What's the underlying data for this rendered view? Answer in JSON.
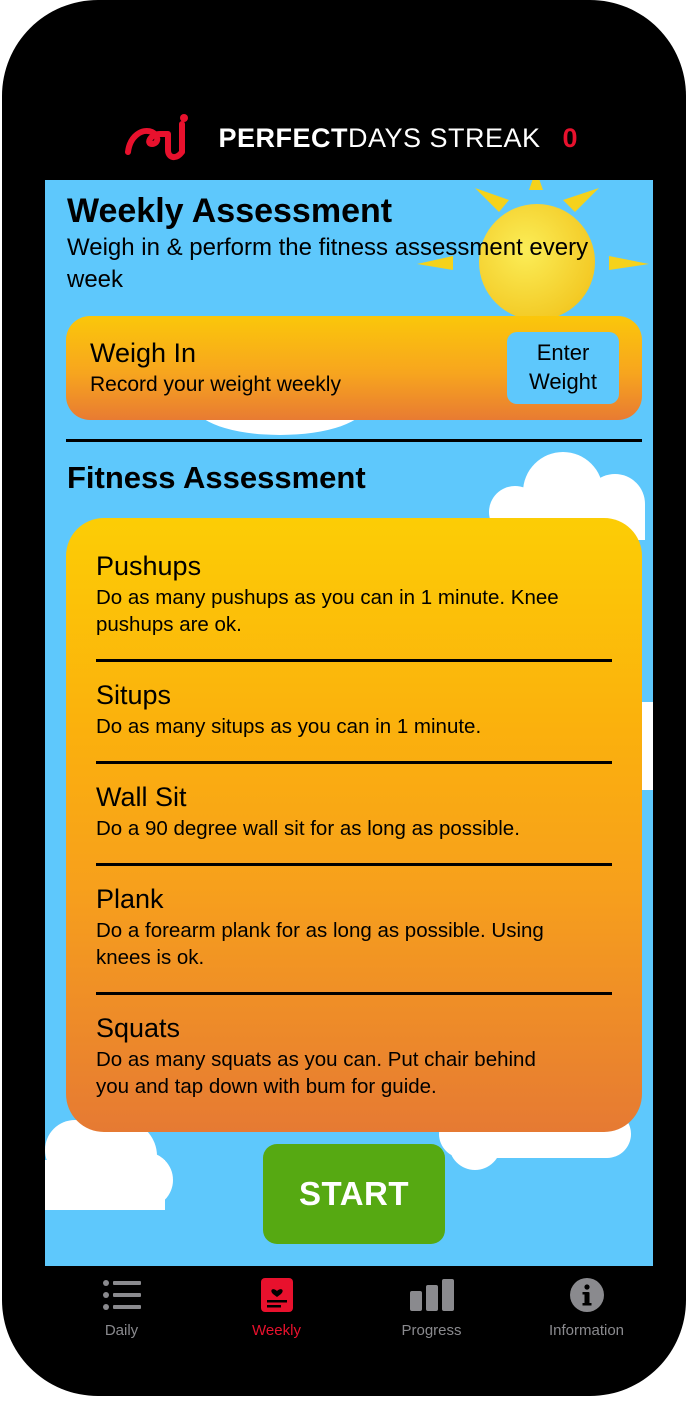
{
  "colors": {
    "brand_red": "#e8112d",
    "sky_blue": "#5ec8fc",
    "card_orange_top": "#fbc70a",
    "card_orange_bottom": "#e87b32",
    "start_green": "#56a912",
    "tab_inactive": "#8a8a8e"
  },
  "header": {
    "logo_icon": "perfectdays-logo-icon",
    "title_bold": "PERFECT",
    "title_rest": "DAYS STREAK",
    "streak_count": "0"
  },
  "weekly": {
    "title": "Weekly Assessment",
    "subtitle": "Weigh in & perform the fitness assessment every week"
  },
  "weigh_in": {
    "title": "Weigh In",
    "subtitle": "Record your weight weekly",
    "button_label_line1": "Enter",
    "button_label_line2": "Weight"
  },
  "fitness": {
    "title": "Fitness Assessment",
    "exercises": [
      {
        "name": "Pushups",
        "desc_line1": "Do as many pushups as you can in 1 minute. Knee",
        "desc_line2": "pushups are ok."
      },
      {
        "name": "Situps",
        "desc_line1": "Do as many situps as you can in 1 minute.",
        "desc_line2": ""
      },
      {
        "name": "Wall Sit",
        "desc_line1": "Do a 90 degree wall sit for as long as possible.",
        "desc_line2": ""
      },
      {
        "name": "Plank",
        "desc_line1": "Do a forearm plank for as long as possible. Using",
        "desc_line2": "knees is ok."
      },
      {
        "name": "Squats",
        "desc_line1": "Do as many squats as you can. Put chair behind",
        "desc_line2": "you and tap down with bum for guide."
      }
    ]
  },
  "start_label": "START",
  "tabs": [
    {
      "label": "Daily",
      "icon": "list-icon",
      "active": false
    },
    {
      "label": "Weekly",
      "icon": "weekly-card-icon",
      "active": true
    },
    {
      "label": "Progress",
      "icon": "bar-chart-icon",
      "active": false
    },
    {
      "label": "Information",
      "icon": "info-icon",
      "active": false
    }
  ]
}
